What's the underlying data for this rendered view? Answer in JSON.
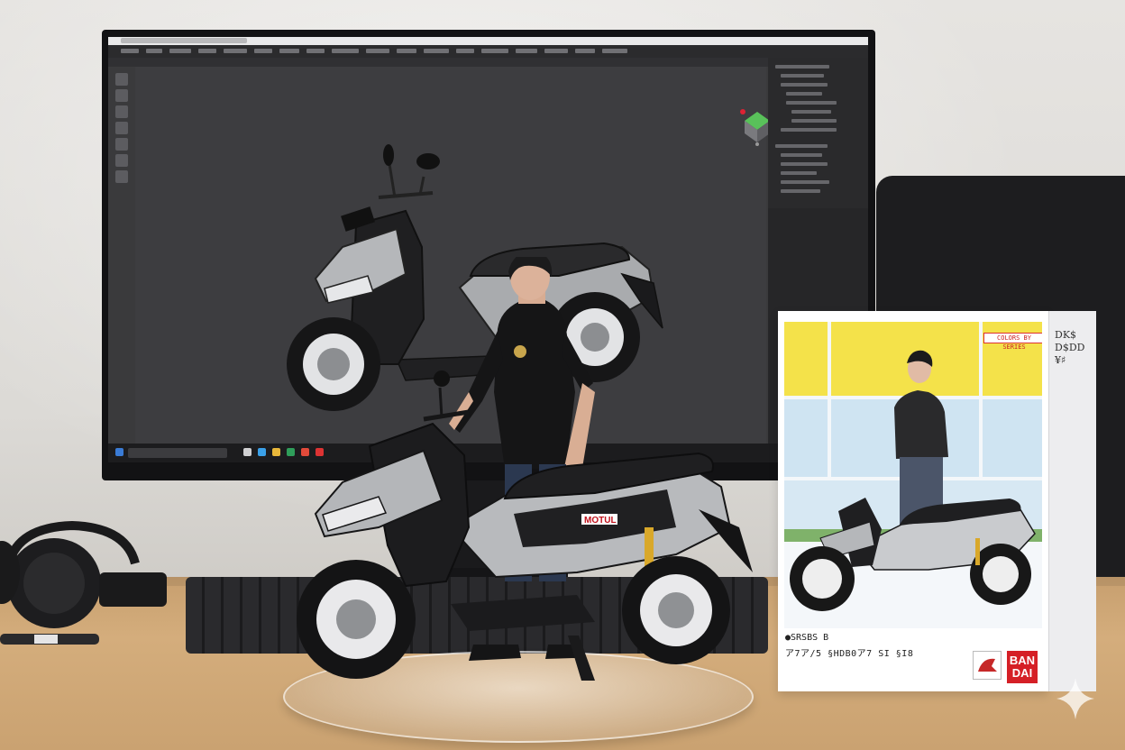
{
  "scene": {
    "description_type": "photo",
    "monitor": {
      "app_menu": [
        "",
        "",
        "",
        "",
        "",
        "",
        ""
      ]
    },
    "box": {
      "brand_band_text": "COLORS BY SERIES",
      "front_line_1": "●SRSBS B",
      "front_line_2": "ア7ア/5 §HDB0ア7 SI §I8",
      "side_text": "DK$ D$DD ¥♯",
      "bandai_logo": "BAN DAI"
    },
    "scooter_decal": "MOTUL",
    "colors": {
      "bandai_red": "#d51f26",
      "box_sky_blue": "#cfe4f2",
      "box_yellow": "#f4e24a",
      "scooter_silver": "#b8babd",
      "scooter_black": "#1a1a1c",
      "desk_wood": "#d0a776"
    }
  }
}
